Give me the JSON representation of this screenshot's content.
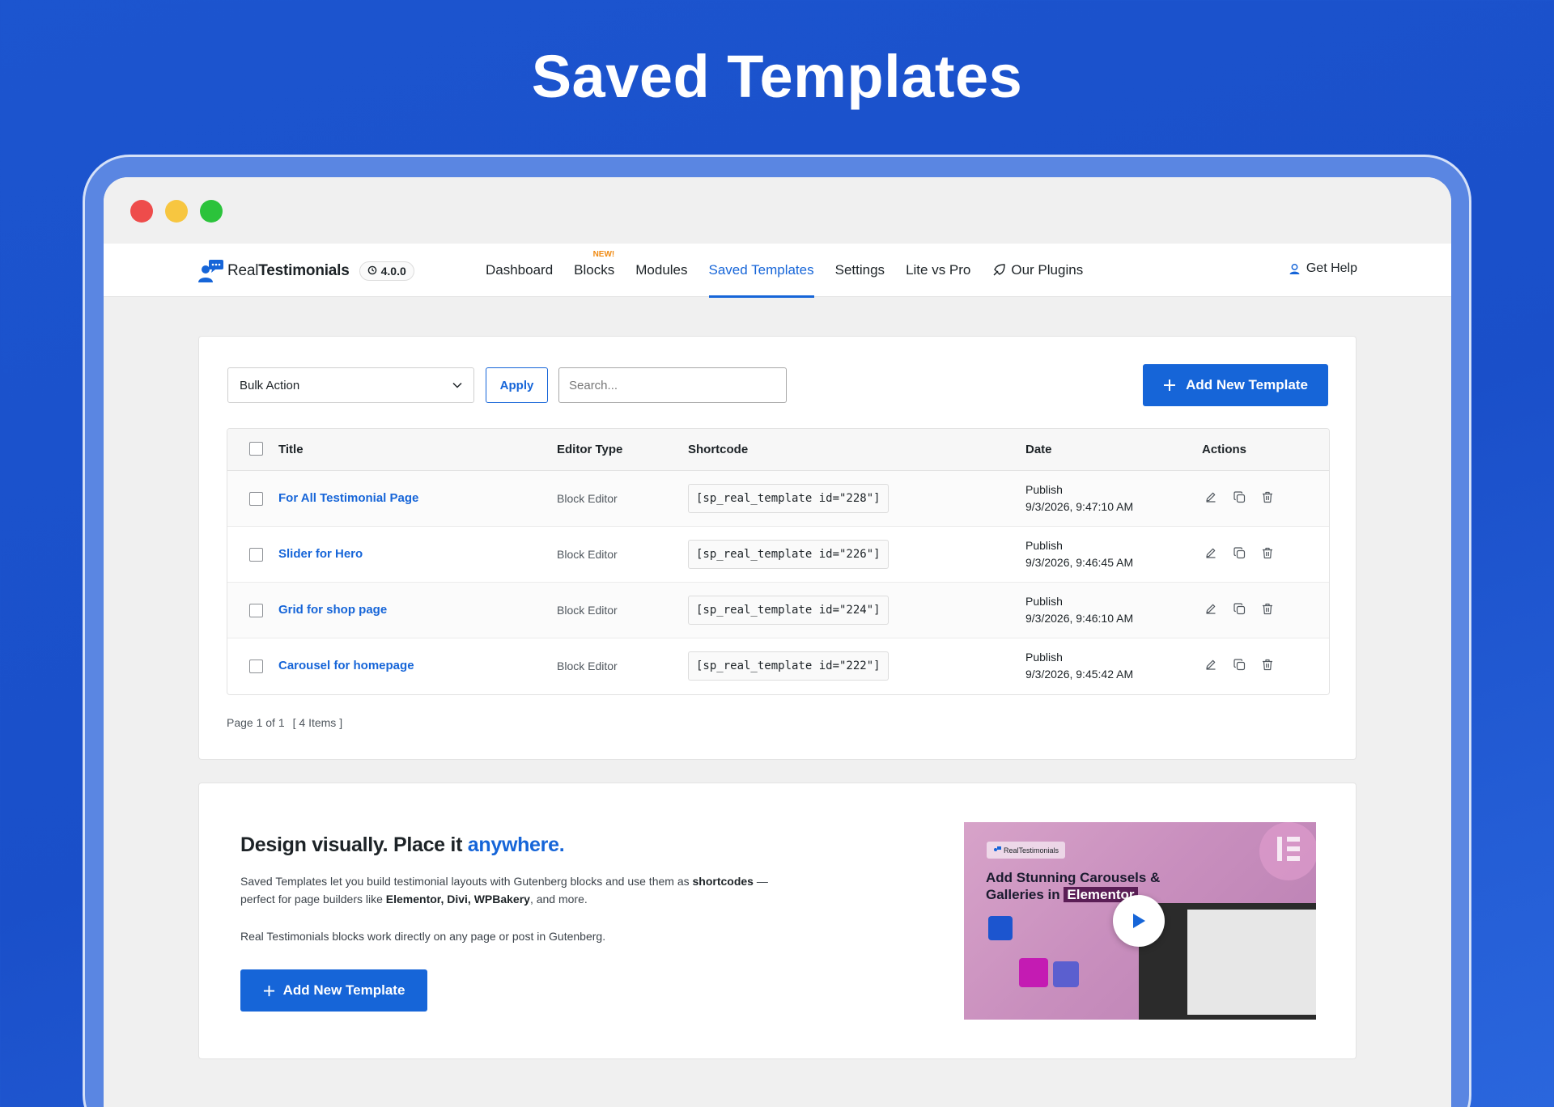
{
  "hero": {
    "title": "Saved Templates"
  },
  "header": {
    "brand_light": "Real",
    "brand_bold": "Testimonials",
    "version": "4.0.0",
    "nav": [
      {
        "label": "Dashboard",
        "active": false
      },
      {
        "label": "Blocks",
        "active": false,
        "badge": "NEW!"
      },
      {
        "label": "Modules",
        "active": false
      },
      {
        "label": "Saved Templates",
        "active": true
      },
      {
        "label": "Settings",
        "active": false
      },
      {
        "label": "Lite vs Pro",
        "active": false
      },
      {
        "label": "Our Plugins",
        "active": false
      }
    ],
    "help_label": "Get Help"
  },
  "toolbar": {
    "bulk_action": "Bulk Action",
    "apply_label": "Apply",
    "search_placeholder": "Search...",
    "add_label": "Add New Template"
  },
  "table": {
    "columns": [
      "Title",
      "Editor Type",
      "Shortcode",
      "Date",
      "Actions"
    ],
    "rows": [
      {
        "title": "For All Testimonial Page",
        "editor": "Block Editor",
        "shortcode": "[sp_real_template id=\"228\"]",
        "status": "Publish",
        "date": "9/3/2026, 9:47:10 AM"
      },
      {
        "title": "Slider for Hero",
        "editor": "Block Editor",
        "shortcode": "[sp_real_template id=\"226\"]",
        "status": "Publish",
        "date": "9/3/2026, 9:46:45 AM"
      },
      {
        "title": "Grid for shop page",
        "editor": "Block Editor",
        "shortcode": "[sp_real_template id=\"224\"]",
        "status": "Publish",
        "date": "9/3/2026, 9:46:10 AM"
      },
      {
        "title": "Carousel for homepage",
        "editor": "Block Editor",
        "shortcode": "[sp_real_template id=\"222\"]",
        "status": "Publish",
        "date": "9/3/2026, 9:45:42 AM"
      }
    ],
    "pager_page": "Page 1 of 1",
    "pager_items": "[ 4 Items ]"
  },
  "promo": {
    "heading_main": "Design visually. Place it ",
    "heading_accent": "anywhere.",
    "p1_a": "Saved Templates let you build testimonial layouts with Gutenberg blocks and use them as ",
    "p1_b": "shortcodes",
    "p1_c": " — perfect for page builders like ",
    "p1_d": "Elementor, Divi, WPBakery",
    "p1_e": ", and more.",
    "p2": "Real Testimonials blocks work directly on any page or post in Gutenberg.",
    "button_label": "Add New Template",
    "video_logo": "RealTestimonials",
    "video_title_1": "Add Stunning Carousels &",
    "video_title_2": "Galleries in ",
    "video_title_hl": "Elementor"
  },
  "colors": {
    "accent": "#1665d8",
    "hero_bg": "#1c55cf",
    "badge": "#f08a12"
  },
  "icons": [
    "brand-chat-user-icon",
    "history-icon",
    "rocket-icon",
    "support-user-icon",
    "chevron-down-icon",
    "plus-icon",
    "edit-icon",
    "duplicate-icon",
    "trash-icon",
    "play-icon",
    "elementor-icon",
    "divi-icon"
  ]
}
